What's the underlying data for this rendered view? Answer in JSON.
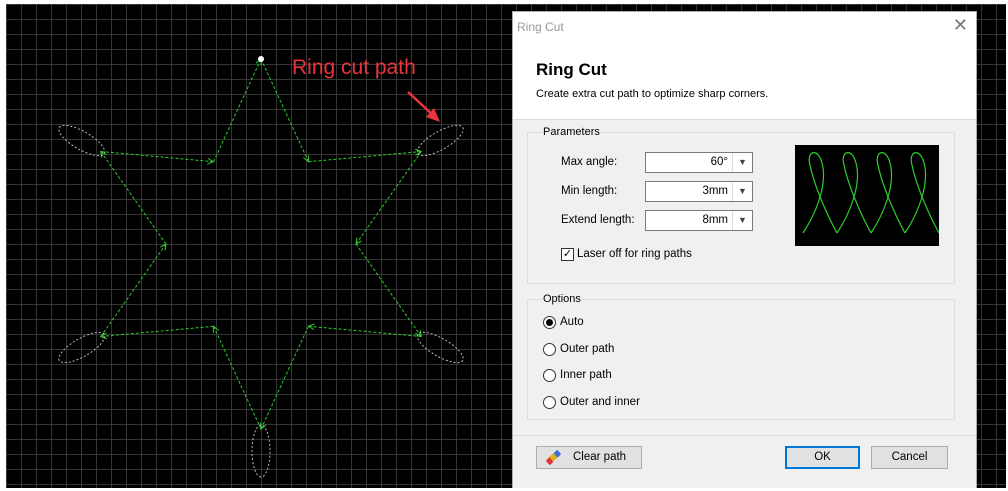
{
  "canvas": {
    "annotation": "Ring cut path",
    "path_color": "#2ccc2c"
  },
  "dialog": {
    "window_title": "Ring Cut",
    "close_glyph": "✕",
    "title": "Ring Cut",
    "subtitle": "Create extra cut path to optimize sharp corners.",
    "parameters": {
      "group_label": "Parameters",
      "max_angle_label": "Max angle:",
      "max_angle_value": "60°",
      "min_length_label": "Min length:",
      "min_length_value": "3mm",
      "extend_length_label": "Extend length:",
      "extend_length_value": "8mm",
      "laser_off_label": "Laser off for ring paths",
      "laser_off_checked": true
    },
    "options": {
      "group_label": "Options",
      "items": [
        {
          "label": "Auto",
          "selected": true
        },
        {
          "label": "Outer path",
          "selected": false
        },
        {
          "label": "Inner path",
          "selected": false
        },
        {
          "label": "Outer and inner",
          "selected": false
        }
      ]
    },
    "buttons": {
      "clear_path": "Clear path",
      "ok": "OK",
      "cancel": "Cancel"
    }
  },
  "icons": {
    "close": "close-icon",
    "dropdown": "chevron-down-icon",
    "clear": "eraser-icon"
  }
}
